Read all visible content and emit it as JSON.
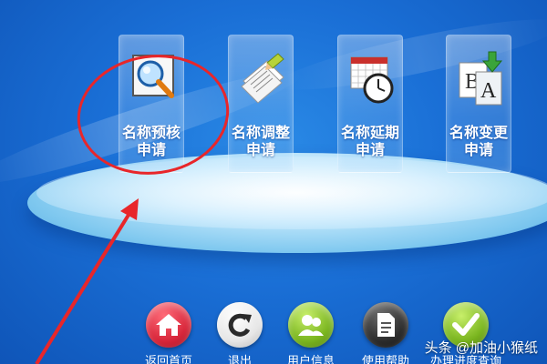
{
  "tiles": [
    {
      "id": "name-precheck",
      "label": "名称预核\n申请",
      "icon": "magnifier-icon"
    },
    {
      "id": "name-adjust",
      "label": "名称调整\n申请",
      "icon": "document-pencil-icon"
    },
    {
      "id": "name-extend",
      "label": "名称延期\n申请",
      "icon": "calendar-clock-icon"
    },
    {
      "id": "name-change",
      "label": "名称变更\n申请",
      "icon": "letters-swap-icon"
    }
  ],
  "bottom_nav": [
    {
      "label": "返回首页",
      "icon": "home-icon",
      "color": "#d8263a"
    },
    {
      "label": "退出",
      "icon": "refresh-icon",
      "color": "#f2f2f2"
    },
    {
      "label": "用户信息",
      "icon": "users-icon",
      "color": "#7ab51f"
    },
    {
      "label": "使用帮助",
      "icon": "document-icon",
      "color": "#2c2c2c"
    },
    {
      "label": "办理进度查询",
      "icon": "checkmark-icon",
      "color": "#7ab51f"
    }
  ],
  "watermark": "头条 @加油小猴纸",
  "colors": {
    "background": "#1a6fd6",
    "annotation": "#e8262a"
  }
}
